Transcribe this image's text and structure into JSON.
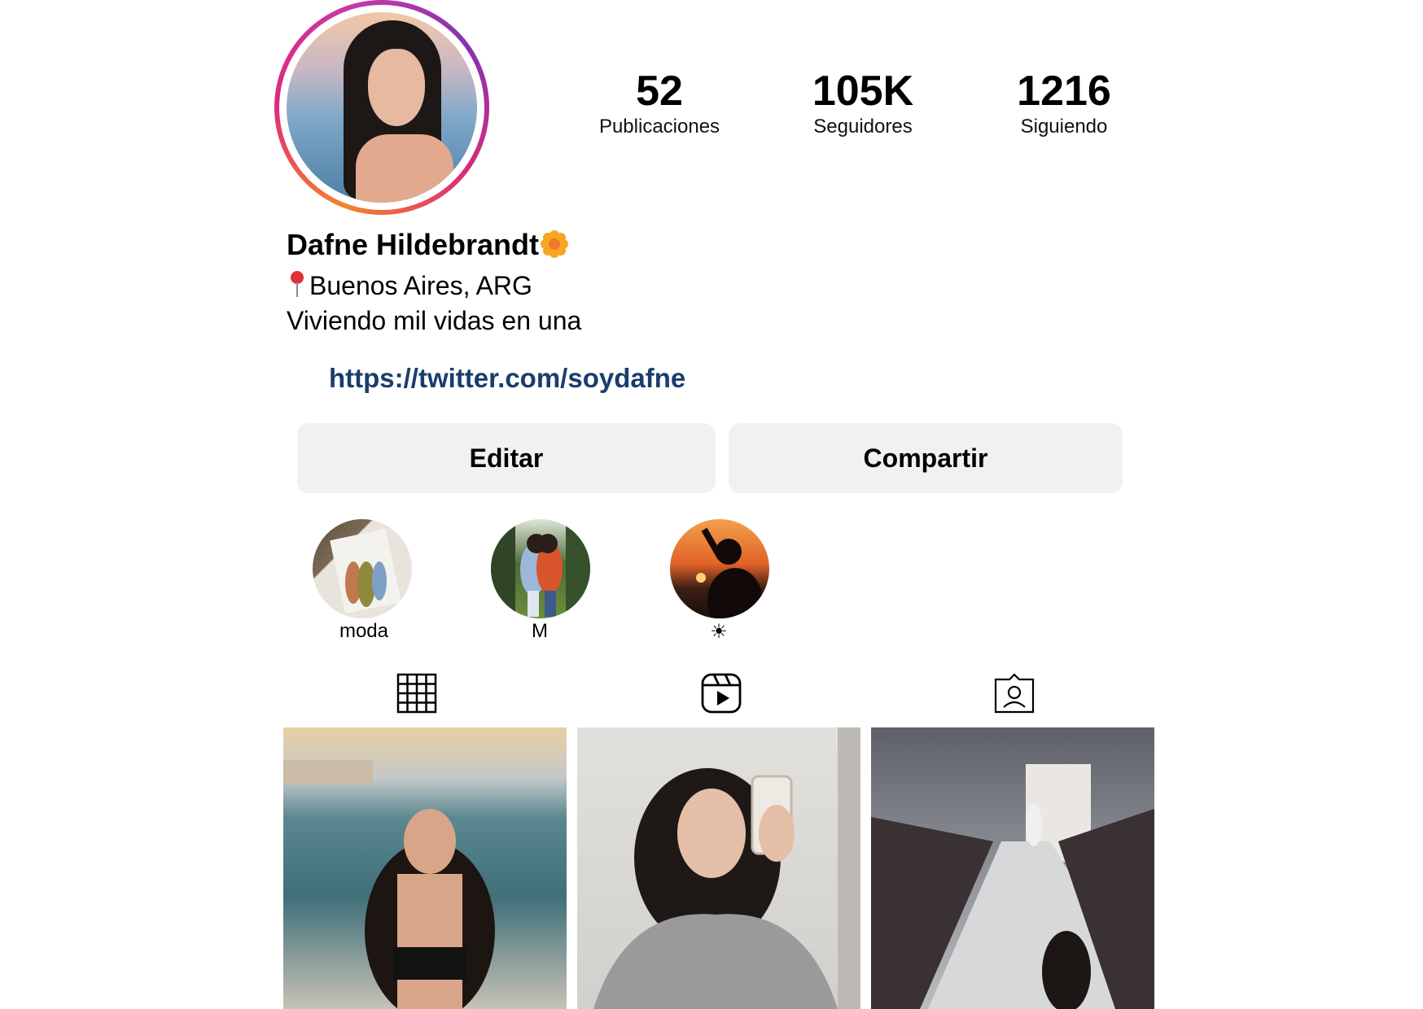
{
  "profile": {
    "name": "Dafne Hildebrandt",
    "location": "Buenos Aires, ARG",
    "bio": "Viviendo mil vidas en una",
    "link": "https://twitter.com/soydafne"
  },
  "stats": [
    {
      "value": "52",
      "label": "Publicaciones"
    },
    {
      "value": "105K",
      "label": "Seguidores"
    },
    {
      "value": "1216",
      "label": "Siguiendo"
    }
  ],
  "buttons": {
    "edit_label": "Editar",
    "share_label": "Compartir"
  },
  "highlights": [
    {
      "label": "moda"
    },
    {
      "label": "M"
    },
    {
      "label": "☀"
    }
  ],
  "tabs": [
    {
      "icon": "grid-icon"
    },
    {
      "icon": "reels-icon"
    },
    {
      "icon": "tagged-icon"
    }
  ],
  "colors": {
    "link": "#1a3d6e",
    "button_bg": "#f1f1f1",
    "story_ring_start": "#f58529",
    "story_ring_end": "#c837ab"
  }
}
